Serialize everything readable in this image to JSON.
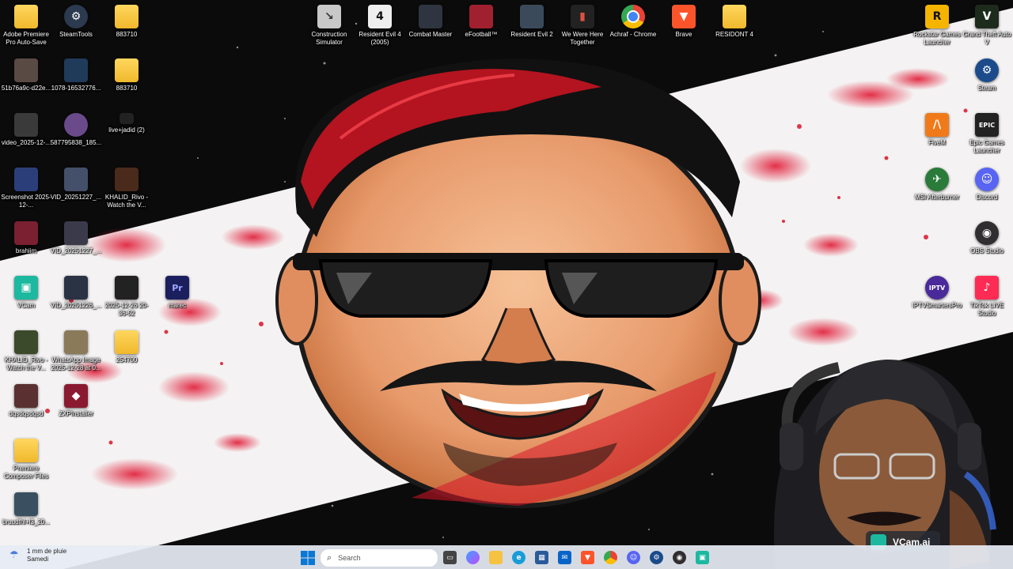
{
  "desktop": {
    "icons_left": [
      {
        "label": "Adobe Premiere Pro Auto-Save",
        "type": "folder"
      },
      {
        "label": "SteamTools",
        "type": "app"
      },
      {
        "label": "883710",
        "type": "folder"
      },
      {
        "label": "51b76a9c-d22e...",
        "type": "image"
      },
      {
        "label": "1078-16532776...",
        "type": "image"
      },
      {
        "label": "883710",
        "type": "folder"
      },
      {
        "label": "video_2025-12-...",
        "type": "video"
      },
      {
        "label": "587795838_185...",
        "type": "image"
      },
      {
        "label": "live+jadid (2)",
        "type": "image"
      },
      {
        "label": "Screenshot 2025-12-...",
        "type": "image"
      },
      {
        "label": "VID_20251227_...",
        "type": "video"
      },
      {
        "label": "KHALID_Rivo - Watch the V...",
        "type": "video"
      },
      {
        "label": "brahiim",
        "type": "image"
      },
      {
        "label": "VID_20251227_...",
        "type": "video"
      },
      {
        "label": "VCam",
        "type": "app"
      },
      {
        "label": "VID_20251226_...",
        "type": "video"
      },
      {
        "label": "2025-12-26 20-36-52",
        "type": "video"
      },
      {
        "label": "marec",
        "type": "premiere"
      },
      {
        "label": "KHALID_Rivo - Watch the V...",
        "type": "video"
      },
      {
        "label": "WhatsApp Image 2025-12-28 at 0...",
        "type": "image"
      },
      {
        "label": "254700",
        "type": "folder"
      },
      {
        "label": "dqsdqsdqsd",
        "type": "image"
      },
      {
        "label": "ZXPInstaller",
        "type": "app"
      },
      {
        "label": "Premiere Composer Files",
        "type": "folder"
      },
      {
        "label": "bruudfhl+l3_20...",
        "type": "image"
      }
    ],
    "icons_top": [
      {
        "label": "Construction Simulator"
      },
      {
        "label": "Resident Evil 4 (2005)"
      },
      {
        "label": "Combat Master"
      },
      {
        "label": "eFootball™"
      },
      {
        "label": "Resident Evil 2"
      },
      {
        "label": "We Were Here Together"
      },
      {
        "label": "Achraf - Chrome"
      },
      {
        "label": "Brave"
      },
      {
        "label": "RESIDONT 4"
      }
    ],
    "icons_right": [
      {
        "label": "Rockstar Games Launcher"
      },
      {
        "label": "Grand Theft Auto V"
      },
      {
        "label": "Steam"
      },
      {
        "label": "FiveM"
      },
      {
        "label": "Epic Games Launcher"
      },
      {
        "label": "MSI Afterburner"
      },
      {
        "label": "Discord"
      },
      {
        "label": "OBS Studio"
      },
      {
        "label": "IPTVSmartersPro"
      },
      {
        "label": "TikTok LIVE Studio"
      }
    ]
  },
  "taskbar": {
    "weather_line1": "1 mm de pluie",
    "weather_line2": "Samedi",
    "search_placeholder": "Search",
    "apps": [
      "task-view",
      "copilot",
      "file-explorer",
      "edge",
      "store",
      "outlook",
      "brave",
      "chrome",
      "discord",
      "steam",
      "obs",
      "vcam"
    ]
  },
  "webcam": {
    "badge_label": "VCam.ai"
  },
  "colors": {
    "accent_red": "#d8152a",
    "taskbar_bg": "#e6ecf4",
    "folder": "#f5c242"
  }
}
